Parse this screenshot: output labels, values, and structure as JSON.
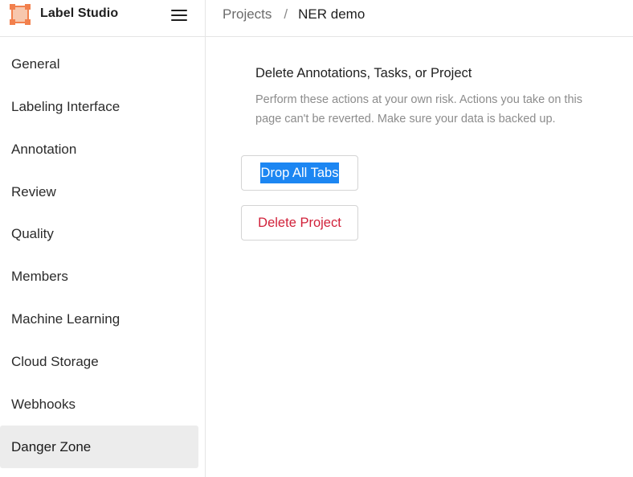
{
  "app": {
    "name": "Label Studio"
  },
  "breadcrumb": {
    "root": "Projects",
    "separator": "/",
    "current": "NER demo"
  },
  "sidebar": {
    "items": [
      {
        "label": "General",
        "active": false
      },
      {
        "label": "Labeling Interface",
        "active": false
      },
      {
        "label": "Annotation",
        "active": false
      },
      {
        "label": "Review",
        "active": false
      },
      {
        "label": "Quality",
        "active": false
      },
      {
        "label": "Members",
        "active": false
      },
      {
        "label": "Machine Learning",
        "active": false
      },
      {
        "label": "Cloud Storage",
        "active": false
      },
      {
        "label": "Webhooks",
        "active": false
      },
      {
        "label": "Danger Zone",
        "active": true
      }
    ]
  },
  "danger_zone": {
    "title": "Delete Annotations, Tasks, or Project",
    "description": "Perform these actions at your own risk. Actions you take on this page can't be reverted. Make sure your data is backed up.",
    "drop_tabs_label": "Drop All Tabs",
    "delete_project_label": "Delete Project"
  },
  "colors": {
    "accent": "#1c86f2",
    "danger": "#d1213a",
    "logo_orange": "#f2804d",
    "active_bg": "#ececec"
  },
  "icons": {
    "logo": "label-studio-logo",
    "menu": "hamburger-menu-icon"
  }
}
